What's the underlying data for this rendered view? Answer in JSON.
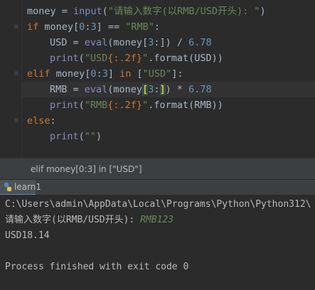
{
  "editor": {
    "lines": [
      {
        "parts": [
          "money",
          " = ",
          "input",
          "(",
          "\"请输入数字(以RMB/USD开头): \"",
          ")"
        ]
      },
      {
        "parts": [
          "if",
          " money[",
          "0",
          ":",
          "3",
          "] == ",
          "\"RMB\"",
          ":"
        ]
      },
      {
        "parts": [
          "USD = ",
          "eval",
          "(money[",
          "3",
          ":]) / ",
          "6.78"
        ]
      },
      {
        "parts": [
          "print",
          "(",
          "\"USD",
          "{:.2f}",
          "\"",
          ".format(USD))"
        ]
      },
      {
        "parts": [
          "elif",
          " money[",
          "0",
          ":",
          "3",
          "] ",
          "in",
          " [",
          "\"USD\"",
          "]:"
        ]
      },
      {
        "parts": [
          "RMB = ",
          "eval",
          "(money",
          "[",
          "3",
          ":",
          "]",
          ") * ",
          "6.78"
        ]
      },
      {
        "parts": [
          "print",
          "(",
          "\"RMB",
          "{:.2f}",
          "\"",
          ".format(RMB))"
        ]
      },
      {
        "parts": [
          "else",
          ":"
        ]
      },
      {
        "parts": [
          "print",
          "(",
          "\"\"",
          ")"
        ]
      }
    ]
  },
  "hint": {
    "text": "elif money[0:3] in [\"USD\"]"
  },
  "run_panel": {
    "tab_label": "learn1",
    "console": {
      "command": "C:\\Users\\admin\\AppData\\Local\\Programs\\Python\\Python312\\",
      "prompt": "请输入数字(以RMB/USD开头): ",
      "user_input": "RMB123",
      "output": "USD18.14",
      "exit_message": "Process finished with exit code 0"
    }
  }
}
